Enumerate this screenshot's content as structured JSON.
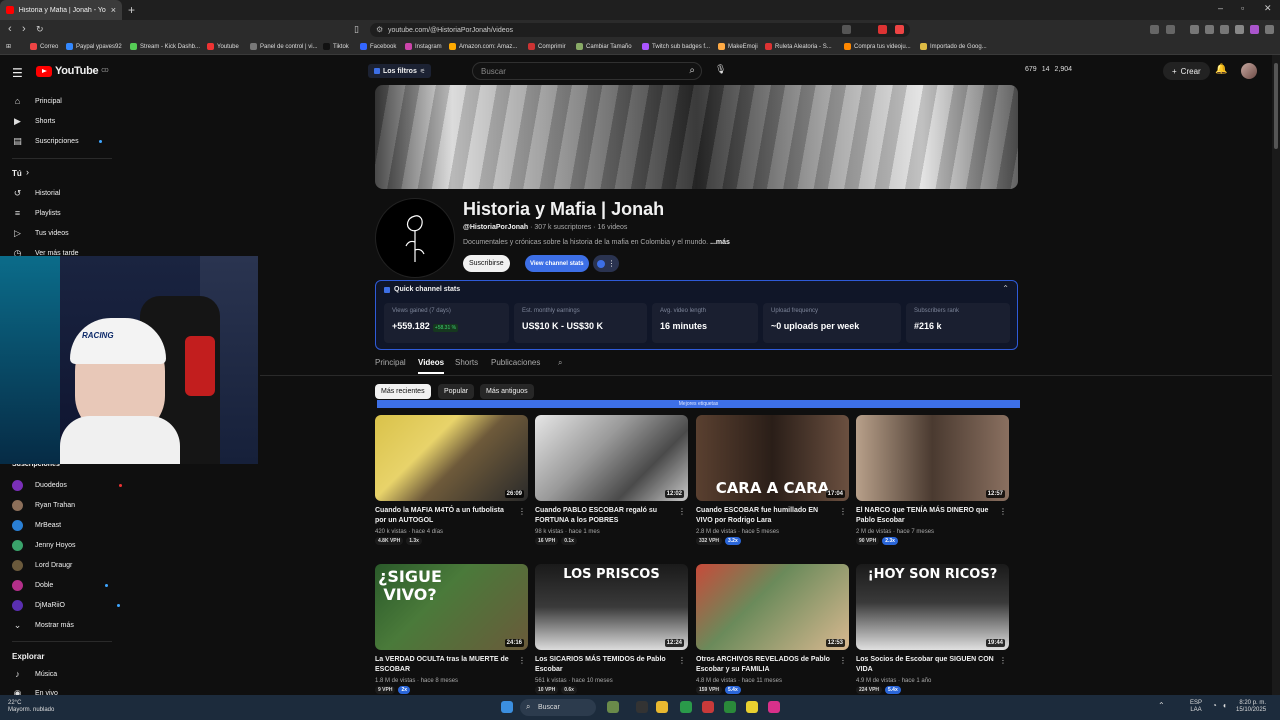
{
  "browser": {
    "tab_title": "Historia y Mafia | Jonah - YouTu",
    "url": "youtube.com/@HistoriaPorJonah/videos",
    "bookmarks": [
      "Correo",
      "Paypal ypaves92",
      "Stream - Kick Dashb...",
      "Youtube",
      "Panel de control | vi...",
      "Tiktok",
      "Facebook",
      "Instagram",
      "Amazon.com: Amaz...",
      "Comprimir",
      "Cambiar Tamaño",
      "Twitch sub badges f...",
      "MakeEmoji",
      "Ruleta Aleatoria - S...",
      "Compra tus videoju...",
      "Importado de Goog..."
    ]
  },
  "header": {
    "logo": "YouTube",
    "logo_region": "CO",
    "filters_label": "Los filtros",
    "search_placeholder": "Buscar",
    "stats": [
      "679",
      "14",
      "2,904"
    ],
    "create_label": "Crear"
  },
  "sidebar": {
    "main": [
      {
        "label": "Principal",
        "icon": "home-icon"
      },
      {
        "label": "Shorts",
        "icon": "shorts-icon"
      },
      {
        "label": "Suscripciones",
        "icon": "subscriptions-icon"
      }
    ],
    "you_title": "Tú",
    "you_items": [
      {
        "label": "Historial",
        "icon": "history-icon"
      },
      {
        "label": "Playlists",
        "icon": "playlists-icon"
      },
      {
        "label": "Tus videos",
        "icon": "your-videos-icon"
      },
      {
        "label": "Ver más tarde",
        "icon": "watch-later-icon"
      }
    ],
    "subs_title": "Suscripciones",
    "subs": [
      {
        "name": "Duodedos",
        "color": "#7a2fb8",
        "live": true
      },
      {
        "name": "Ryan Trahan",
        "color": "#8c6f5a",
        "live": false
      },
      {
        "name": "MrBeast",
        "color": "#2a7fd4",
        "live": false
      },
      {
        "name": "Jenny Hoyos",
        "color": "#3aa36b",
        "live": false
      },
      {
        "name": "Lord Draugr",
        "color": "#6b5a3c",
        "live": false
      },
      {
        "name": "Doble",
        "color": "#b32f8a",
        "live": true
      },
      {
        "name": "DjMaRiiO",
        "color": "#5a2fb0",
        "live": true
      }
    ],
    "more_label": "Mostrar más",
    "explore_title": "Explorar",
    "explore": [
      {
        "label": "Música",
        "icon": "music-icon"
      },
      {
        "label": "En vivo",
        "icon": "live-icon"
      }
    ]
  },
  "channel": {
    "name": "Historia y Mafia | Jonah",
    "handle": "@HistoriaPorJonah",
    "subscribers": "307 k suscriptores",
    "video_count": "16 videos",
    "description": "Documentales y crónicas sobre la historia de la mafia en Colombia y el mundo.",
    "more": "...más",
    "subscribe_label": "Suscribirse",
    "stats_label": "View channel stats"
  },
  "quick_stats": {
    "title": "Quick channel stats",
    "cards": [
      {
        "label": "Views gained (7 days)",
        "value": "+559.182",
        "badge": "+58.31 %"
      },
      {
        "label": "Est. monthly earnings",
        "value": "US$10 K - US$30 K",
        "badge": ""
      },
      {
        "label": "Avg. video length",
        "value": "16 minutes",
        "badge": ""
      },
      {
        "label": "Upload frequency",
        "value": "~0 uploads per week",
        "badge": ""
      },
      {
        "label": "Subscribers rank",
        "value": "#216 k",
        "badge": ""
      }
    ]
  },
  "tabs": [
    "Principal",
    "Videos",
    "Shorts",
    "Publicaciones"
  ],
  "chips": [
    "Más recientes",
    "Popular",
    "Más antiguos"
  ],
  "banner_label": "Mejores etiquetas",
  "videos": [
    {
      "title": "Cuando la MAFIA M4TÓ a un futbolista por un AUTOGOL",
      "views": "420 k vistas",
      "age": "hace 4 días",
      "duration": "26:09",
      "vph": "4.8K VPH",
      "ratio": "1.3x",
      "overlay": "",
      "bg": "linear-gradient(135deg,#d9c24a 0%,#e8d36a 35%,#6e5a3a 55%,#2a2a2a 100%)"
    },
    {
      "title": "Cuando PABLO ESCOBAR regaló su FORTUNA a los POBRES",
      "views": "98 k vistas",
      "age": "hace 1 mes",
      "duration": "12:02",
      "vph": "16 VPH",
      "ratio": "0.1x",
      "overlay": "",
      "bg": "linear-gradient(135deg,#e6e6e6 0%,#9a9a9a 40%,#4a4a4a 70%,#c8c8c8 100%)"
    },
    {
      "title": "Cuando ESCOBAR fue humillado EN VIVO por Rodrigo Lara",
      "views": "2.8 M de vistas",
      "age": "hace 5 meses",
      "duration": "17:04",
      "vph": "332 VPH",
      "ratio": "3.2x",
      "overlay": "CARA A CARA",
      "bg": "linear-gradient(90deg,#5a4030 0%,#2a1e18 50%,#6b5040 100%)"
    },
    {
      "title": "El NARCO que TENÍA MÁS DINERO que Pablo Escobar",
      "views": "2 M de vistas",
      "age": "hace 7 meses",
      "duration": "12:57",
      "vph": "90 VPH",
      "ratio": "2.3x",
      "overlay": "",
      "bg": "linear-gradient(90deg,#b8a08a 0%,#4a3a30 50%,#8a7060 100%)"
    },
    {
      "title": "La VERDAD OCULTA tras la MUERTE de ESCOBAR",
      "views": "1.8 M de vistas",
      "age": "hace 8 meses",
      "duration": "24:16",
      "vph": "9 VPH",
      "ratio": "2x",
      "overlay": "¿SIGUE VIVO?",
      "bg": "linear-gradient(135deg,#2a5a2a 0%,#4a7a3a 40%,#6a5a3a 100%)"
    },
    {
      "title": "Los SICARIOS MÁS TEMIDOS de Pablo Escobar",
      "views": "561 k vistas",
      "age": "hace 10 meses",
      "duration": "12:24",
      "vph": "10 VPH",
      "ratio": "0.6x",
      "overlay": "LOS PRISCOS",
      "bg": "linear-gradient(180deg,#1a1a1a 0%,#3a3a3a 50%,#dcdcdc 100%)"
    },
    {
      "title": "Otros ARCHIVOS REVELADOS de Pablo Escobar y su FAMILIA",
      "views": "4.8 M de vistas",
      "age": "hace 11 meses",
      "duration": "12:53",
      "vph": "159 VPH",
      "ratio": "5.4x",
      "overlay": "",
      "bg": "linear-gradient(135deg,#c84a3a 0%,#6a8a5a 40%,#d8b890 100%)"
    },
    {
      "title": "Los Socios de Escobar que SIGUEN CON VIDA",
      "views": "4.9 M de vistas",
      "age": "hace 1 año",
      "duration": "19:44",
      "vph": "224 VPH",
      "ratio": "5.4x",
      "overlay": "¡HOY SON RICOS?",
      "bg": "linear-gradient(180deg,#1a1a1a 0%,#3a3a3a 45%,#e0e0e0 100%)"
    }
  ],
  "taskbar": {
    "weather_temp": "22°C",
    "weather_desc": "Mayorm. nublado",
    "search": "Buscar",
    "lang": "ESP",
    "lang2": "LAA",
    "time": "8:20 p. m.",
    "date": "15/10/2025"
  }
}
